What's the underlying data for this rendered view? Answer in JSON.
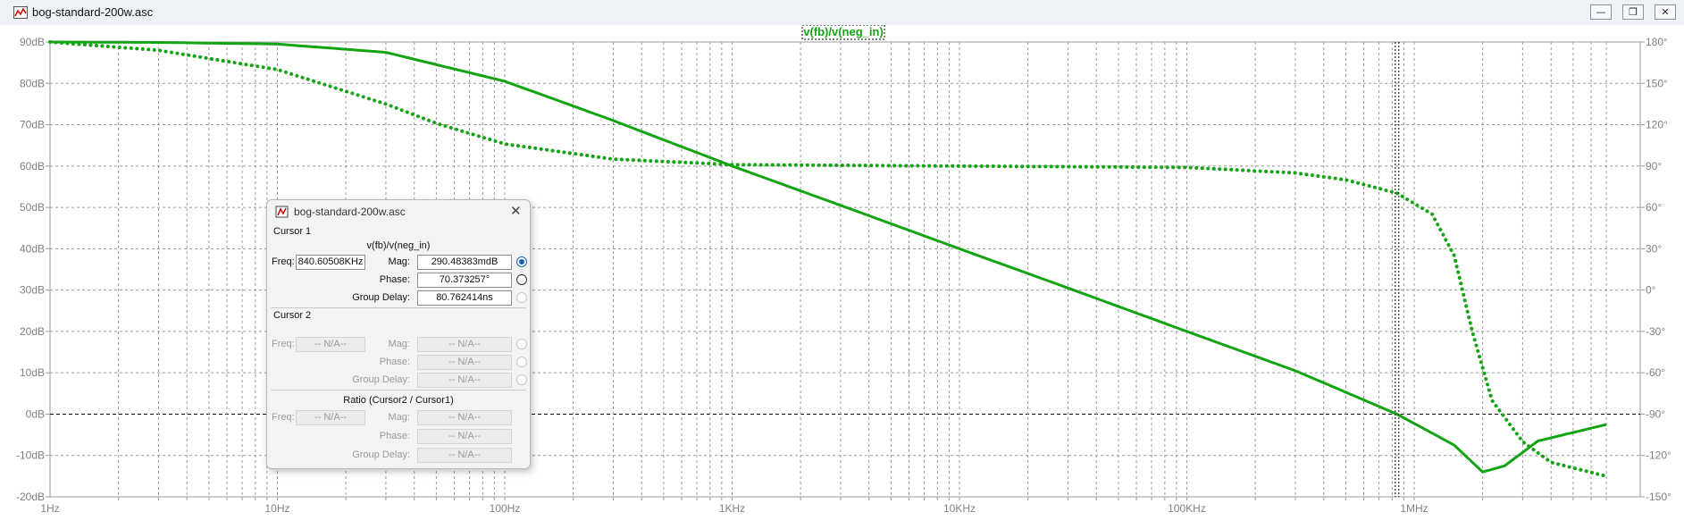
{
  "window": {
    "title": "bog-standard-200w.asc"
  },
  "plot": {
    "trace_label": "v(fb)/v(neg_in)",
    "colors": {
      "trace": "#13a413",
      "grid": "#9a9a9a",
      "axis_text": "#808080",
      "cursor": "#000000"
    },
    "left_ticks": [
      "90dB",
      "80dB",
      "70dB",
      "60dB",
      "50dB",
      "40dB",
      "30dB",
      "20dB",
      "10dB",
      "0dB",
      "-10dB",
      "-20dB"
    ],
    "right_ticks": [
      "180°",
      "150°",
      "120°",
      "90°",
      "60°",
      "30°",
      "0°",
      "-30°",
      "-60°",
      "-90°",
      "-120°",
      "-150°"
    ],
    "x_ticks": [
      "1Hz",
      "10Hz",
      "100Hz",
      "1KHz",
      "10KHz",
      "100KHz",
      "1MHz"
    ]
  },
  "chart_data": {
    "type": "line",
    "title": "v(fb)/v(neg_in)",
    "x_scale": "log",
    "xlim": [
      1,
      7000000
    ],
    "ylim_left": [
      -20,
      90
    ],
    "ylim_right": [
      -150,
      180
    ],
    "grid": true,
    "cursor_freq_hz": 840605.08,
    "series": [
      {
        "name": "v(fb)/v(neg_in)",
        "style": "solid",
        "axis": "left",
        "x": [
          1,
          3,
          10,
          30,
          100,
          300,
          1000,
          3000,
          10000,
          30000,
          100000,
          300000,
          840605,
          1500000,
          2000000,
          2500000,
          3500000,
          7000000
        ],
        "y": [
          90,
          89.9,
          89.5,
          87.5,
          80.5,
          71,
          60,
          50.5,
          40,
          30.5,
          20,
          10.5,
          0,
          -7.5,
          -14,
          -12.5,
          -6.5,
          -2.5
        ]
      },
      {
        "name": "v(fb)/v(neg_in)",
        "style": "dotted",
        "axis": "right",
        "x": [
          1,
          3,
          10,
          30,
          50,
          100,
          300,
          1000,
          10000,
          100000,
          300000,
          500000,
          840605,
          1200000,
          1500000,
          1800000,
          2200000,
          3000000,
          4000000,
          7000000
        ],
        "y": [
          180,
          174,
          160,
          135,
          121,
          106,
          95,
          91,
          90,
          89,
          85,
          80,
          70.3,
          55,
          25,
          -30,
          -80,
          -110,
          -125,
          -135
        ]
      }
    ]
  },
  "dialog": {
    "title": "bog-standard-200w.asc",
    "cursor1": {
      "label": "Cursor 1",
      "trace": "v(fb)/v(neg_in)",
      "freq_label": "Freq:",
      "freq": "840.60508KHz",
      "mag_label": "Mag:",
      "mag": "290.48383mdB",
      "phase_label": "Phase:",
      "phase": "70.373257°",
      "gd_label": "Group Delay:",
      "gd": "80.762414ns"
    },
    "cursor2": {
      "label": "Cursor 2",
      "freq_label": "Freq:",
      "freq": "-- N/A--",
      "mag_label": "Mag:",
      "mag": "-- N/A--",
      "phase_label": "Phase:",
      "phase": "-- N/A--",
      "gd_label": "Group Delay:",
      "gd": "-- N/A--"
    },
    "ratio": {
      "label": "Ratio (Cursor2 / Cursor1)",
      "freq_label": "Freq:",
      "freq": "-- N/A--",
      "mag_label": "Mag:",
      "mag": "-- N/A--",
      "phase_label": "Phase:",
      "phase": "-- N/A--",
      "gd_label": "Group Delay:",
      "gd": "-- N/A--"
    }
  }
}
